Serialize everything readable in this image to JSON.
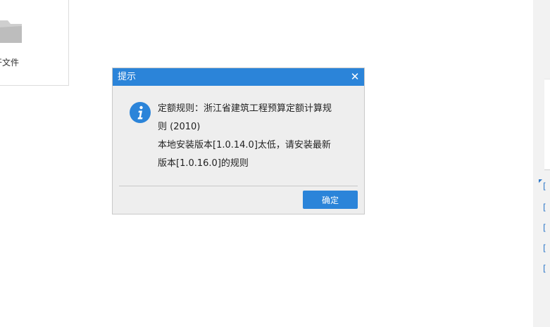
{
  "background": {
    "open_file_label": "开文件",
    "right_links": [
      "[",
      "[",
      "[",
      "[",
      "["
    ]
  },
  "dialog": {
    "title": "提示",
    "close_symbol": "✕",
    "message_lines": [
      "定额规则：浙江省建筑工程预算定额计算规",
      "则 (2010)",
      "本地安装版本[1.0.14.0]太低，请安装最新",
      "版本[1.0.16.0]的规则"
    ],
    "ok_label": "确定"
  },
  "colors": {
    "accent": "#2b84d9",
    "dialog_bg": "#eeeeee",
    "link": "#2f78c8"
  }
}
